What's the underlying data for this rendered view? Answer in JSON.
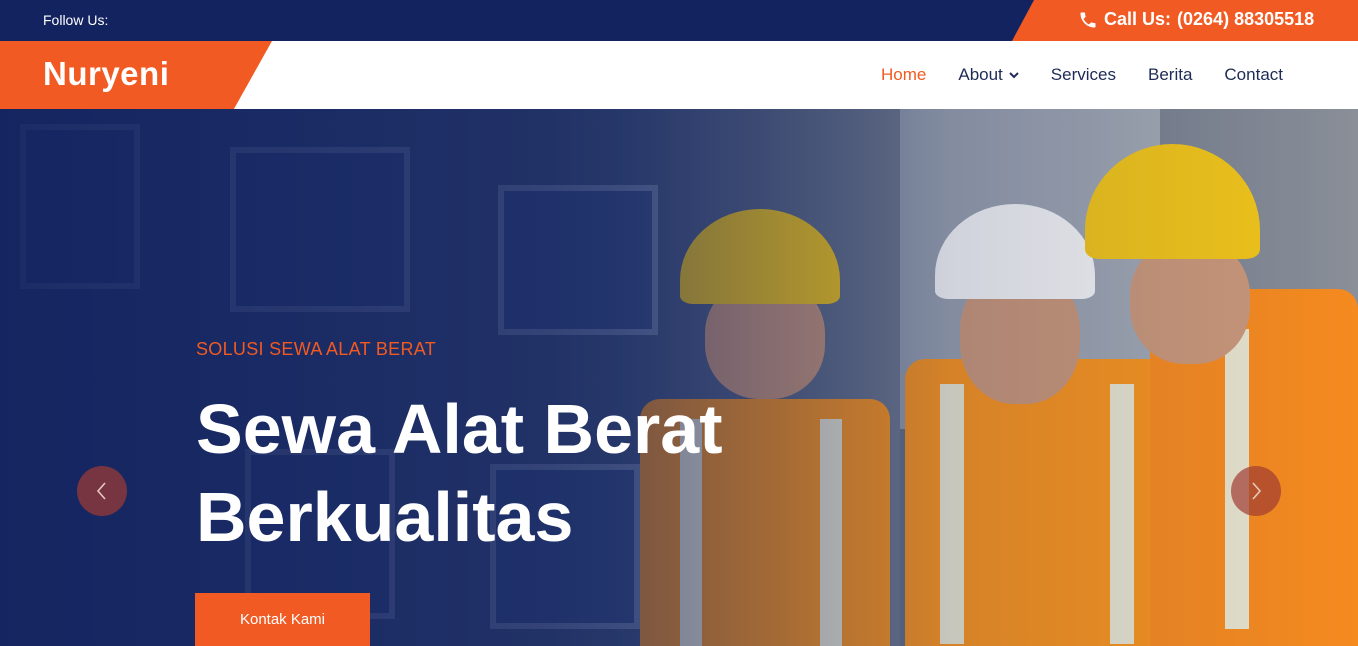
{
  "topbar": {
    "follow_label": "Follow Us:",
    "call_label": "Call Us:",
    "phone": "(0264) 88305518",
    "phone_icon": "phone-icon"
  },
  "brand": {
    "name": "Nuryeni"
  },
  "nav": {
    "items": [
      {
        "label": "Home",
        "active": true
      },
      {
        "label": "About",
        "has_dropdown": true
      },
      {
        "label": "Services"
      },
      {
        "label": "Berita"
      },
      {
        "label": "Contact"
      }
    ]
  },
  "hero": {
    "subtitle": "SOLUSI SEWA ALAT BERAT",
    "title": "Sewa Alat Berat Berkualitas",
    "cta_label": "Kontak Kami",
    "prev_icon": "chevron-left-icon",
    "next_icon": "chevron-right-icon"
  },
  "colors": {
    "accent": "#f15a22",
    "navy": "#13235f",
    "nav_text": "#1d2b55"
  }
}
